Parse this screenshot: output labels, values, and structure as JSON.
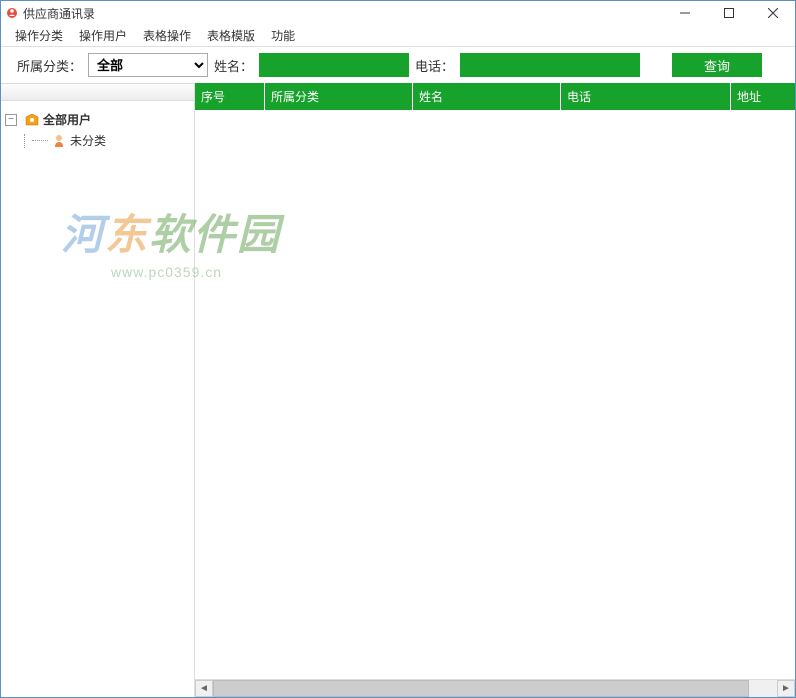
{
  "window": {
    "title": "供应商通讯录"
  },
  "menu": {
    "items": [
      "操作分类",
      "操作用户",
      "表格操作",
      "表格模版",
      "功能"
    ]
  },
  "toolbar": {
    "category_label": "所属分类：",
    "category_value": "全部",
    "name_label": "姓名：",
    "name_value": "",
    "phone_label": "电话：",
    "phone_value": "",
    "search_label": "查询"
  },
  "tree": {
    "root_label": "全部用户",
    "child_label": "未分类"
  },
  "table": {
    "columns": [
      "序号",
      "所属分类",
      "姓名",
      "电话",
      "地址"
    ],
    "rows": []
  },
  "watermark": {
    "text1": "河",
    "text2": "东",
    "text3": "软件园",
    "url": "www.pc0359.cn"
  },
  "colors": {
    "accent_green": "#17a22b",
    "border_blue": "#5a8fc7"
  }
}
